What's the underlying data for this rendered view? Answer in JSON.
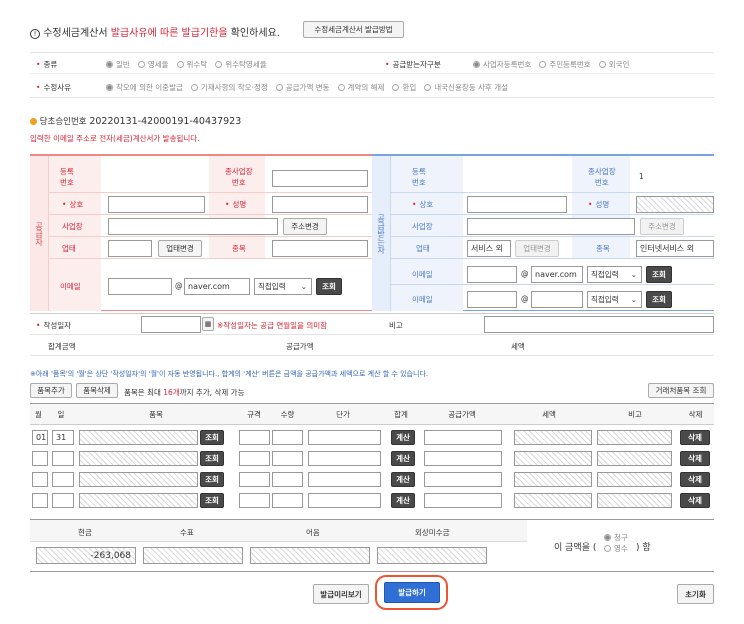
{
  "notice": {
    "part1": "수정세금계산서 ",
    "part2": "발급사유에 따른 발급기한을",
    "part3": " 확인하세요.",
    "btn": "수정세금계산서 발급방법"
  },
  "kind": {
    "label": "종류",
    "options": [
      "일반",
      "영세율",
      "위수탁",
      "위수탁영세율"
    ]
  },
  "receiver_type": {
    "label": "공급받는자구분",
    "options": [
      "사업자등록번호",
      "주민등록번호",
      "외국인"
    ]
  },
  "reason": {
    "label": "수정사유",
    "options": [
      "착오에 의한 이중발급",
      "기재사항의 착오·정정",
      "공급가액 변동",
      "계약의 해제",
      "환입",
      "내국신용장등 사후 개설"
    ]
  },
  "approval": {
    "label": "당초승인번호",
    "value": "20220131-42000191-40437923"
  },
  "email_notice": "입력한 이메일 주소로 전자(세금)계산서가 발송됩니다.",
  "supplier": {
    "side": "공급자",
    "reg_no": "등록\n번호",
    "branch": "종사업장\n번호",
    "name": "상호",
    "ceo": "성명",
    "addr": "사업장",
    "addr_btn": "주소변경",
    "biz_type": "업태",
    "biz_type_btn": "업태변경",
    "item": "종목",
    "email": "이메일",
    "at": "@",
    "domain": "naver.com",
    "select": "직접입력",
    "lookup": "조회"
  },
  "receiver": {
    "side": "공급받는자",
    "reg_no": "등록\n번호",
    "branch": "종사업장\n번호",
    "branch_val": "1",
    "name": "상호",
    "ceo": "성명",
    "addr": "사업장",
    "addr_btn": "주소변경",
    "biz_type": "업태",
    "biz_type_val": "서비스 외",
    "biz_type_btn": "업태변경",
    "item": "종목",
    "item_val": "인터넷서비스 외",
    "email": "이메일",
    "at": "@",
    "domain": "naver.com",
    "select": "직접입력",
    "lookup": "조회"
  },
  "write_date": {
    "label": "작성일자",
    "note": "※작성일자는 공급 연월일을 의미함",
    "memo": "비고"
  },
  "totals": {
    "total": "합계금액",
    "supply": "공급가액",
    "tax": "세액"
  },
  "table_note": "※아래 '품목'의 '월'은 상단 '작성일자'의 '월'이 자동 반영됩니다., 합계의 '계산' 버튼은 금액을 공급가액과 세액으로 계산 할 수 있습니다.",
  "item_btns": {
    "add": "품목추가",
    "del": "품목삭제",
    "max1": "품목은 최대 ",
    "max2": "16개",
    "max3": "까지 추가, 삭제 가능",
    "trade": "거래처품목 조회"
  },
  "table": {
    "headers": [
      "월",
      "일",
      "품목",
      "규격",
      "수량",
      "단가",
      "합계",
      "공급가액",
      "세액",
      "비고",
      "삭제"
    ],
    "row1": {
      "month": "01",
      "day": "31"
    },
    "lookup": "조회",
    "calc": "계산",
    "delete": "삭제"
  },
  "payment": {
    "cash": "현금",
    "check": "수표",
    "note": "어음",
    "credit": "외상미수금",
    "cash_val": "-263,068",
    "amount1": "이 금액을 (",
    "claim": "청구",
    "receipt": "영수",
    "amount2": ") 함"
  },
  "bottom": {
    "preview": "발급미리보기",
    "issue": "발급하기",
    "reset": "초기화"
  }
}
